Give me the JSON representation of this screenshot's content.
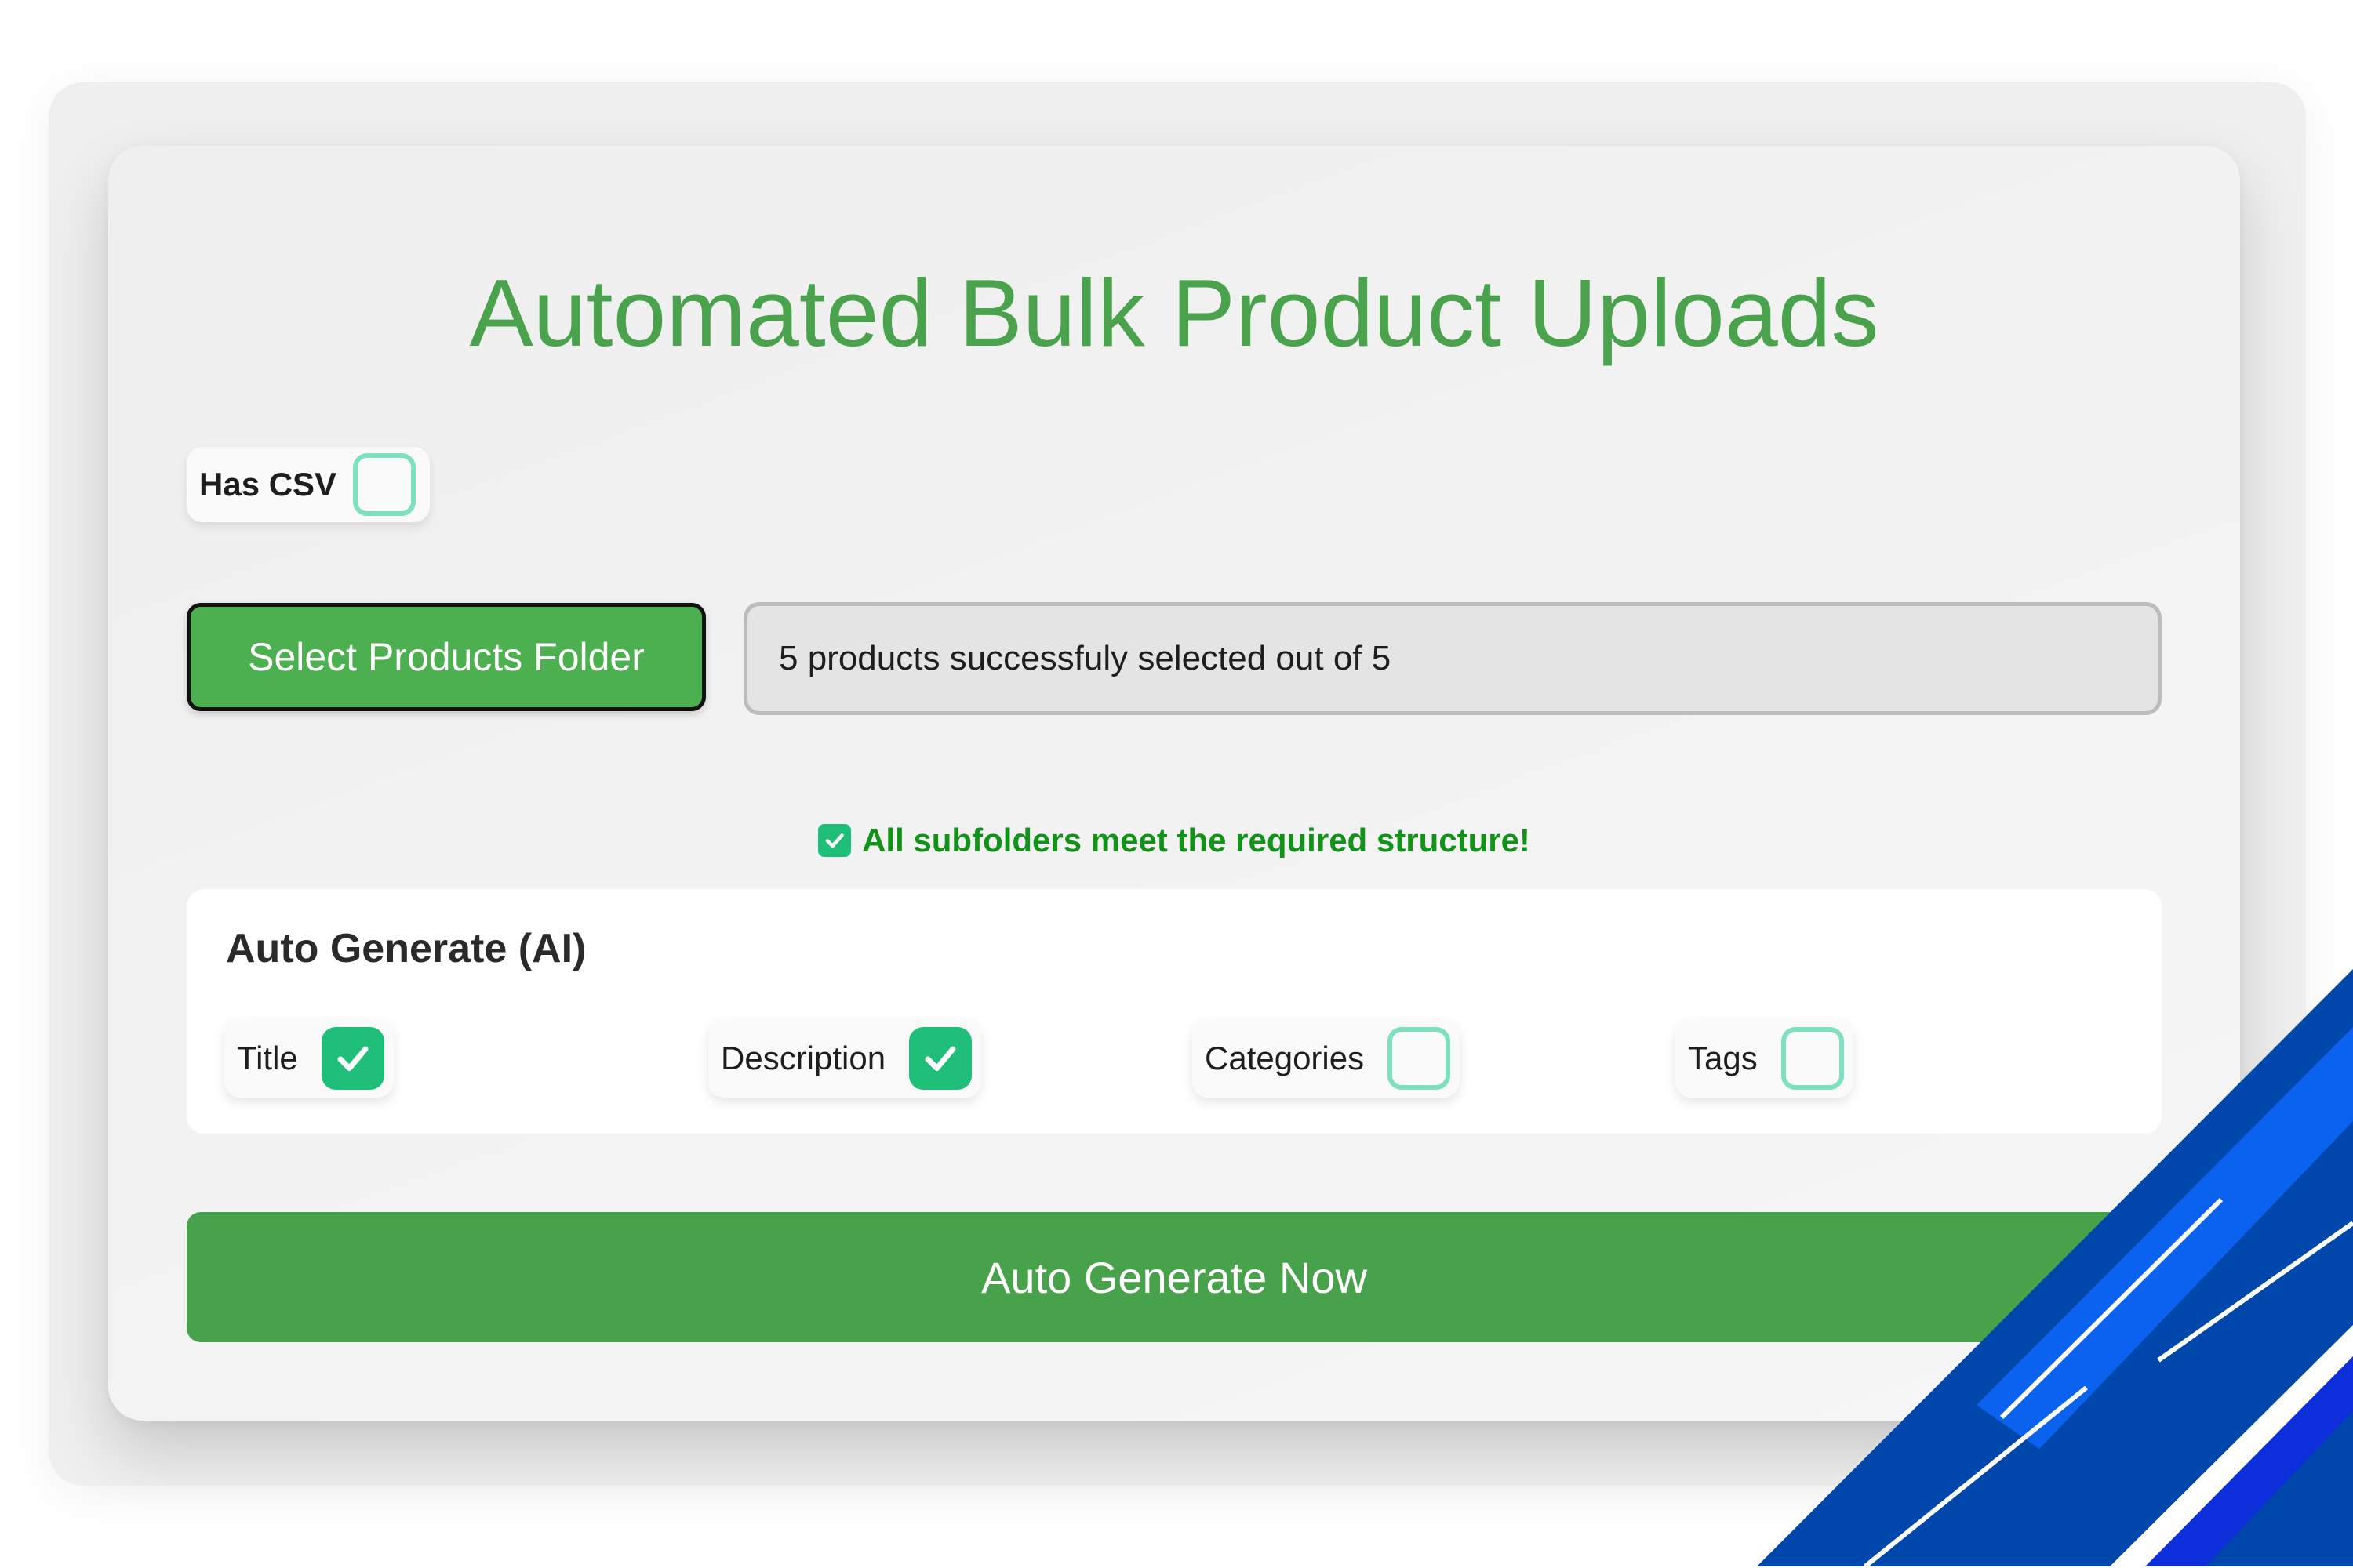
{
  "page": {
    "title": "Automated Bulk Product Uploads"
  },
  "csv_toggle": {
    "label": "Has CSV",
    "checked": false
  },
  "folder": {
    "select_button_label": "Select Products Folder",
    "status_text": "5 products successfuly selected out of 5"
  },
  "validation": {
    "message": "All subfolders meet the required structure!",
    "icon": "check-square-icon"
  },
  "ai_section": {
    "title": "Auto Generate (AI)",
    "options": [
      {
        "label": "Title",
        "checked": true
      },
      {
        "label": "Description",
        "checked": true
      },
      {
        "label": "Categories",
        "checked": false
      },
      {
        "label": "Tags",
        "checked": false
      }
    ]
  },
  "actions": {
    "generate_label": "Auto Generate Now"
  },
  "colors": {
    "accent_green": "#4aa24c",
    "button_green": "#48a24c",
    "checkbox_green": "#1fbf7a",
    "checkbox_outline": "#7de0bf",
    "success_text": "#13921a",
    "deco_blue": "#0047ab"
  }
}
